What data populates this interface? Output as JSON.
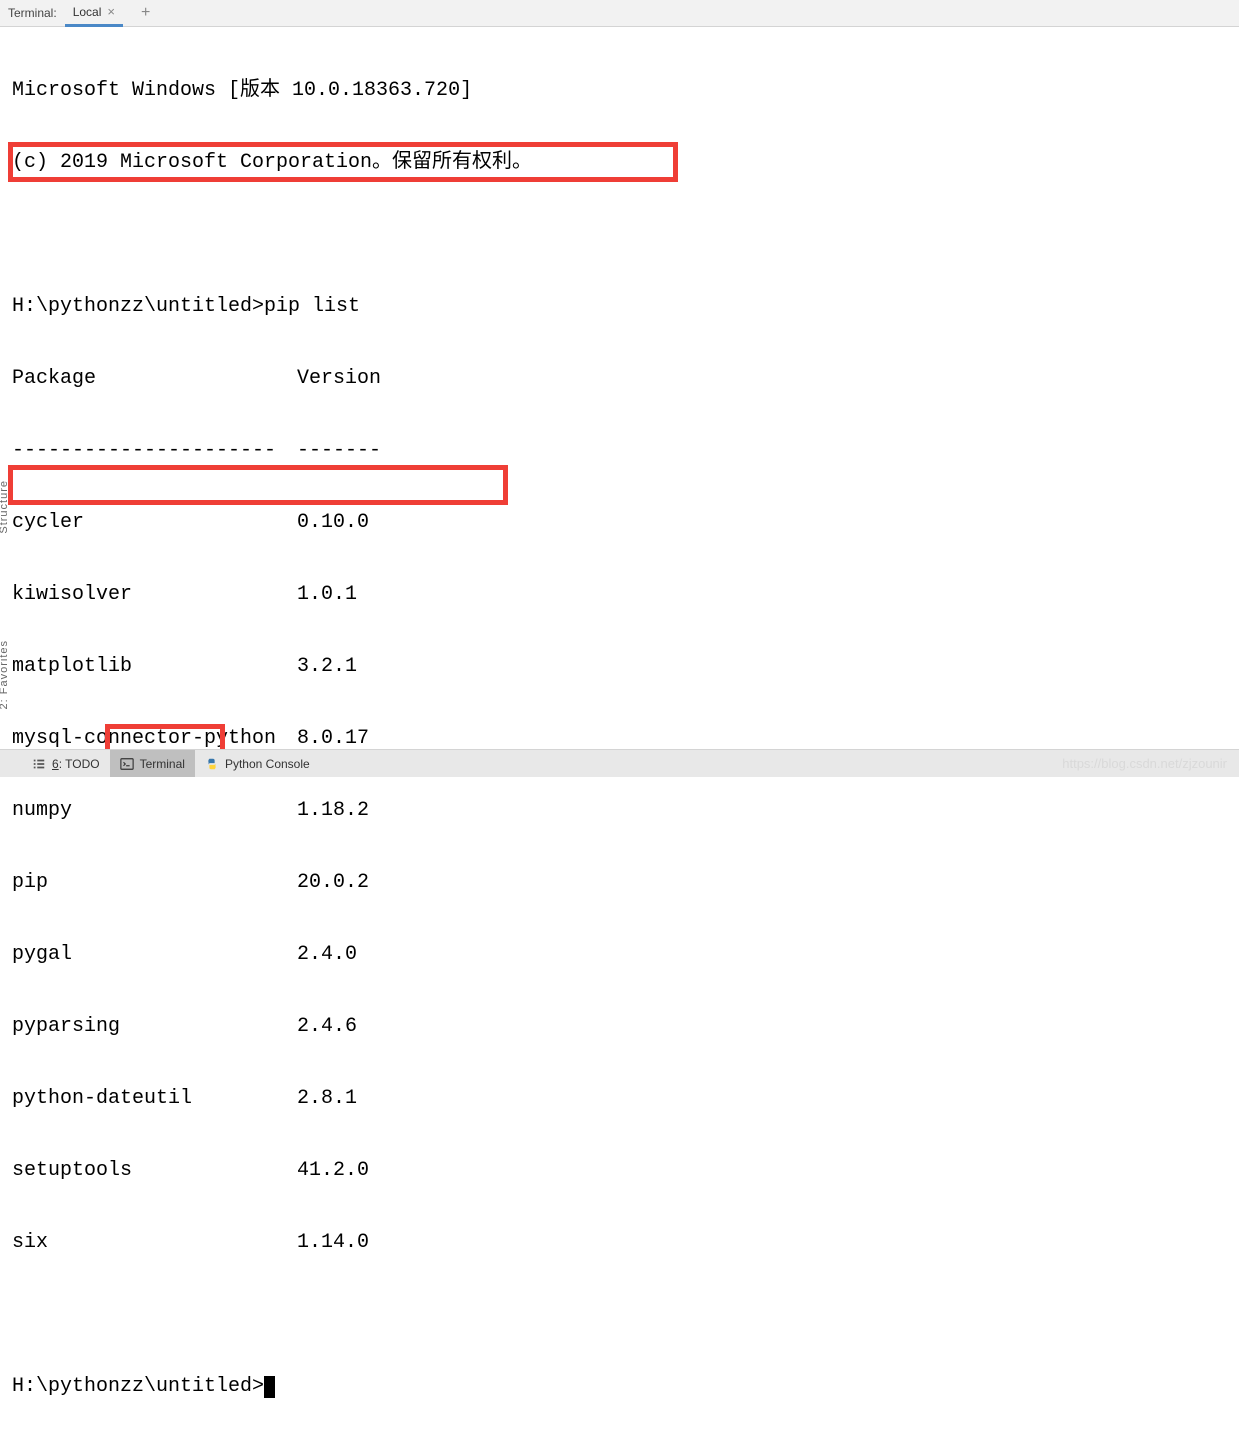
{
  "tabbar": {
    "label": "Terminal:",
    "tab_name": "Local",
    "close_glyph": "×",
    "add_glyph": "+"
  },
  "terminal": {
    "banner_line1": "Microsoft Windows [版本 10.0.18363.720]",
    "banner_line2": "(c) 2019 Microsoft Corporation。保留所有权利。",
    "prompt1": "H:\\pythonzz\\untitled>pip list",
    "header_pkg": "Package",
    "header_ver": "Version",
    "divider_pkg": "----------------------",
    "divider_ver": "-------",
    "packages": [
      {
        "name": "cycler",
        "version": "0.10.0"
      },
      {
        "name": "kiwisolver",
        "version": "1.0.1"
      },
      {
        "name": "matplotlib",
        "version": "3.2.1"
      },
      {
        "name": "mysql-connector-python",
        "version": "8.0.17"
      },
      {
        "name": "numpy",
        "version": "1.18.2"
      },
      {
        "name": "pip",
        "version": "20.0.2"
      },
      {
        "name": "pygal",
        "version": "2.4.0"
      },
      {
        "name": "pyparsing",
        "version": "2.4.6"
      },
      {
        "name": "python-dateutil",
        "version": "2.8.1"
      },
      {
        "name": "setuptools",
        "version": "41.2.0"
      },
      {
        "name": "six",
        "version": "1.14.0"
      }
    ],
    "prompt2": "H:\\pythonzz\\untitled>"
  },
  "bottom": {
    "todo_prefix": "6",
    "todo_label": ": TODO",
    "terminal_label": "Terminal",
    "pyconsole_label": "Python Console"
  },
  "side": {
    "structure_label": "Structure",
    "favorites_label": "2: Favorites"
  },
  "watermark": "https://blog.csdn.net/zjzounir"
}
